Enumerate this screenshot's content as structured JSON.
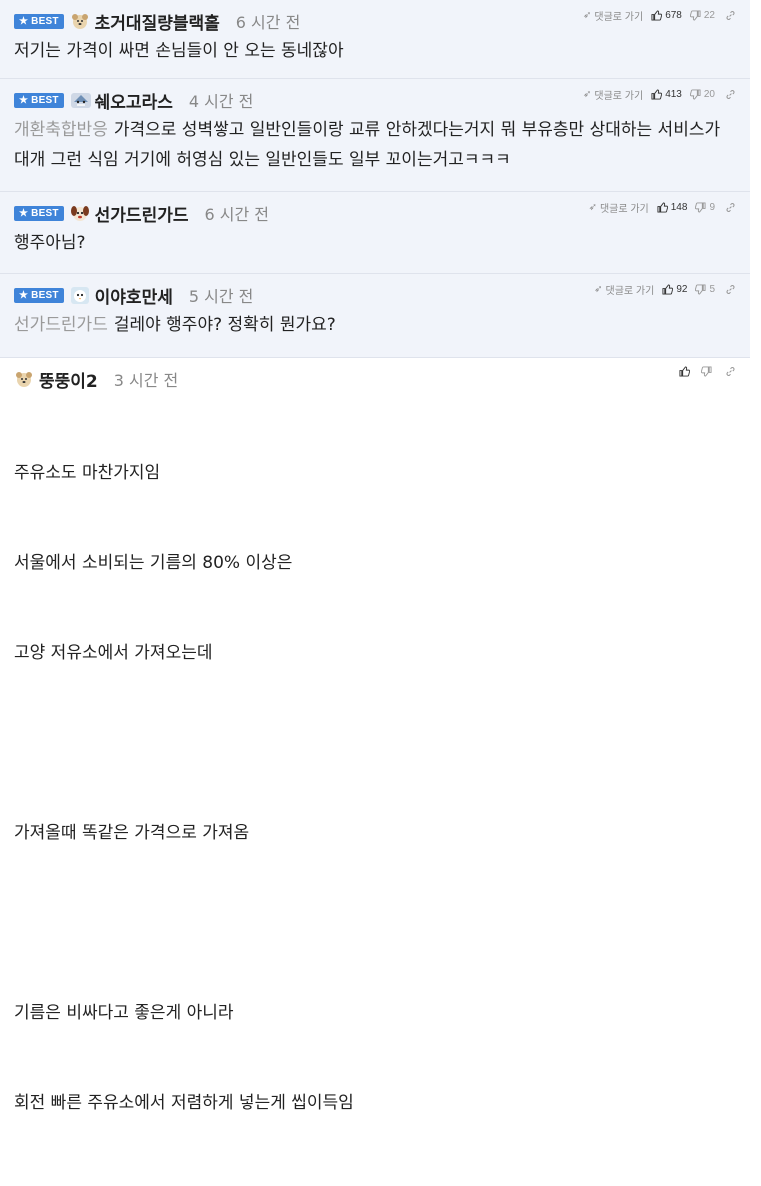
{
  "comments": [
    {
      "best_label": "BEST",
      "nick": "초거대질량블랙홀",
      "time": "6 시간 전",
      "reply_label": "댓글로 가기",
      "upvotes": "678",
      "downvotes": "22",
      "mention": "",
      "text": "저기는 가격이 싸면 손님들이 안 오는 동네잖아"
    },
    {
      "best_label": "BEST",
      "nick": "쉐오고라스",
      "time": "4 시간 전",
      "reply_label": "댓글로 가기",
      "upvotes": "413",
      "downvotes": "20",
      "mention": "개환축합반응",
      "text": "가격으로 성벽쌓고 일반인들이랑 교류 안하겠다는거지 뭐 부유층만 상대하는 서비스가 대개 그런 식임 거기에 허영심 있는 일반인들도 일부 꼬이는거고ㅋㅋㅋ"
    },
    {
      "best_label": "BEST",
      "nick": "선가드린가드",
      "time": "6 시간 전",
      "reply_label": "댓글로 가기",
      "upvotes": "148",
      "downvotes": "9",
      "mention": "",
      "text": "행주아님?"
    },
    {
      "best_label": "BEST",
      "nick": "이야호만세",
      "time": "5 시간 전",
      "reply_label": "댓글로 가기",
      "upvotes": "92",
      "downvotes": "5",
      "mention": "선가드린가드",
      "text": "걸레야 행주야? 정확히 뭔가요?"
    }
  ],
  "normal_comment": {
    "nick": "뚱뚱이2",
    "time": "3 시간 전",
    "lines": [
      "주유소도 마찬가지임",
      "서울에서 소비되는 기름의 80% 이상은",
      "고양 저유소에서 가져오는데",
      "",
      "가져올때 똑같은 가격으로 가져옴",
      "",
      "기름은 비싸다고 좋은게 아니라",
      "회전 빠른 주유소에서 저렴하게 넣는게 씹이득임"
    ]
  },
  "colors": {
    "best_badge": "#3f84d9",
    "best_bg": "#f1f4fa",
    "mention": "#9a9a9a"
  },
  "icons": [
    "star-icon",
    "reply-arrow-icon",
    "thumbs-up-icon",
    "thumbs-down-icon",
    "link-icon",
    "dog-avatar-icon",
    "shark-avatar-icon",
    "puppy-avatar-icon",
    "bird-avatar-icon"
  ]
}
